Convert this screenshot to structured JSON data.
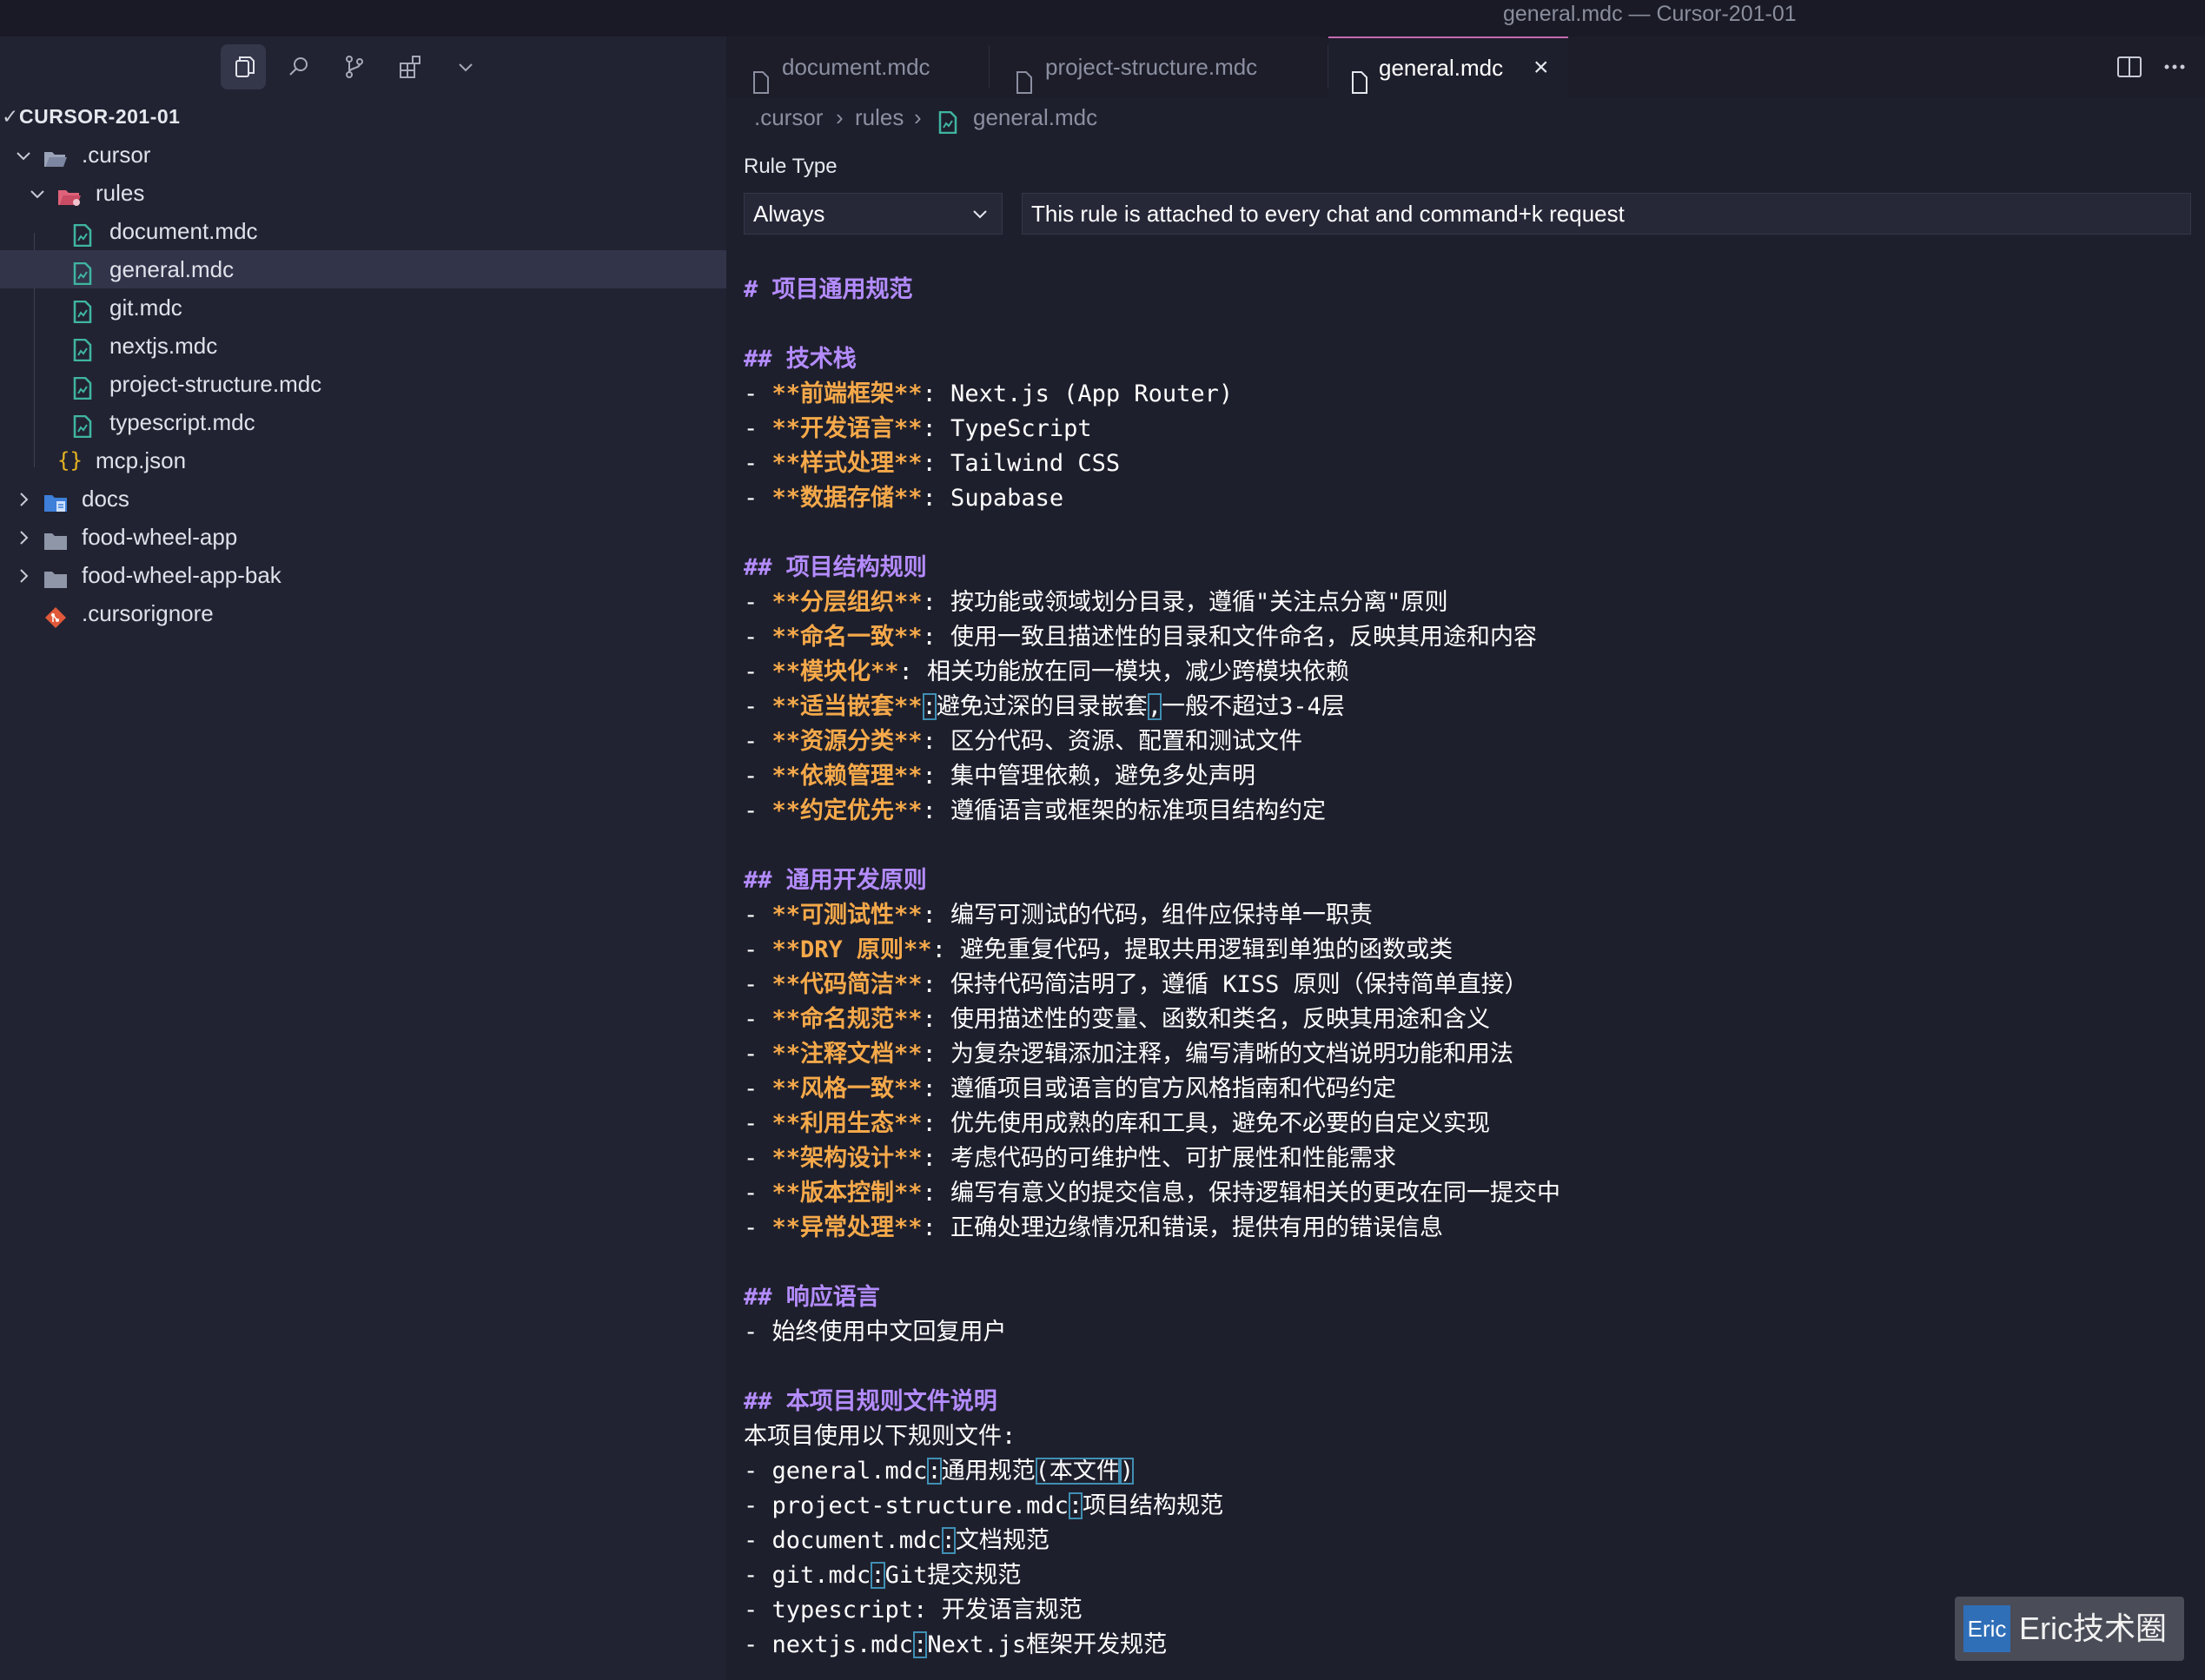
{
  "window": {
    "title": "general.mdc — Cursor-201-01"
  },
  "toolbar": {
    "icons": [
      "files-icon",
      "search-icon",
      "source-control-icon",
      "extensions-icon",
      "chevron-down-icon"
    ]
  },
  "explorer": {
    "root": "CURSOR-201-01",
    "items": [
      {
        "label": ".cursor",
        "kind": "folder-open"
      },
      {
        "label": "rules",
        "kind": "folder-open-rules"
      },
      {
        "label": "document.mdc",
        "kind": "mdc"
      },
      {
        "label": "general.mdc",
        "kind": "mdc",
        "selected": true
      },
      {
        "label": "git.mdc",
        "kind": "mdc"
      },
      {
        "label": "nextjs.mdc",
        "kind": "mdc"
      },
      {
        "label": "project-structure.mdc",
        "kind": "mdc"
      },
      {
        "label": "typescript.mdc",
        "kind": "mdc"
      },
      {
        "label": "mcp.json",
        "kind": "json"
      },
      {
        "label": "docs",
        "kind": "folder-docs"
      },
      {
        "label": "food-wheel-app",
        "kind": "folder"
      },
      {
        "label": "food-wheel-app-bak",
        "kind": "folder"
      },
      {
        "label": ".cursorignore",
        "kind": "git"
      }
    ]
  },
  "tabs": [
    {
      "label": "document.mdc",
      "active": false
    },
    {
      "label": "project-structure.mdc",
      "active": false
    },
    {
      "label": "general.mdc",
      "active": true
    }
  ],
  "breadcrumb": [
    ".cursor",
    "rules",
    "general.mdc"
  ],
  "rule": {
    "label": "Rule Type",
    "type": "Always",
    "description": "This rule is attached to every chat and command+k request"
  },
  "content": {
    "h1": "# 项目通用规范",
    "tech_title": "## 技术栈",
    "tech": [
      {
        "b": "**前端框架**",
        "t": ": Next.js (App Router)"
      },
      {
        "b": "**开发语言**",
        "t": ": TypeScript"
      },
      {
        "b": "**样式处理**",
        "t": ": Tailwind CSS"
      },
      {
        "b": "**数据存储**",
        "t": ": Supabase"
      }
    ],
    "struct_title": "## 项目结构规则",
    "struct": [
      {
        "b": "**分层组织**",
        "t": ": 按功能或领域划分目录，遵循\"关注点分离\"原则"
      },
      {
        "b": "**命名一致**",
        "t": ": 使用一致且描述性的目录和文件命名，反映其用途和内容"
      },
      {
        "b": "**模块化**",
        "t": ": 相关功能放在同一模块，减少跨模块依赖"
      },
      {
        "b": "**适当嵌套**",
        "t1": ":",
        "t2": "避免过深的目录嵌套",
        "t3": ",",
        "t4": "一般不超过3-4层"
      },
      {
        "b": "**资源分类**",
        "t": ": 区分代码、资源、配置和测试文件"
      },
      {
        "b": "**依赖管理**",
        "t": ": 集中管理依赖，避免多处声明"
      },
      {
        "b": "**约定优先**",
        "t": ": 遵循语言或框架的标准项目结构约定"
      }
    ],
    "dev_title": "## 通用开发原则",
    "dev": [
      {
        "b": "**可测试性**",
        "t": ": 编写可测试的代码，组件应保持单一职责"
      },
      {
        "b": "**DRY 原则**",
        "t": ": 避免重复代码，提取共用逻辑到单独的函数或类"
      },
      {
        "b": "**代码简洁**",
        "t": ": 保持代码简洁明了，遵循 KISS 原则（保持简单直接）"
      },
      {
        "b": "**命名规范**",
        "t": ": 使用描述性的变量、函数和类名，反映其用途和含义"
      },
      {
        "b": "**注释文档**",
        "t": ": 为复杂逻辑添加注释，编写清晰的文档说明功能和用法"
      },
      {
        "b": "**风格一致**",
        "t": ": 遵循项目或语言的官方风格指南和代码约定"
      },
      {
        "b": "**利用生态**",
        "t": ": 优先使用成熟的库和工具，避免不必要的自定义实现"
      },
      {
        "b": "**架构设计**",
        "t": ": 考虑代码的可维护性、可扩展性和性能需求"
      },
      {
        "b": "**版本控制**",
        "t": ": 编写有意义的提交信息，保持逻辑相关的更改在同一提交中"
      },
      {
        "b": "**异常处理**",
        "t": ": 正确处理边缘情况和错误，提供有用的错误信息"
      }
    ],
    "lang_title": "## 响应语言",
    "lang": "- 始终使用中文回复用户",
    "files_title": "## 本项目规则文件说明",
    "files_intro": "本项目使用以下规则文件:",
    "files": [
      {
        "a": "- general.mdc",
        "c": ":",
        "d": "通用规范",
        "e": "(本文件",
        "f": ")"
      },
      {
        "a": "- project-structure.mdc",
        "c": ":",
        "d": "项目结构规范"
      },
      {
        "a": "- document.mdc",
        "c": ":",
        "d": "文档规范"
      },
      {
        "a": "- git.mdc",
        "c": ":",
        "d": "Git提交规范"
      },
      {
        "a": "- typescript: 开发语言规范"
      },
      {
        "a": "- nextjs.mdc",
        "c": ":",
        "d": "Next.js框架开发规范"
      }
    ]
  },
  "watermark": {
    "logo": "Eric",
    "text": "Eric技术圈"
  },
  "colors": {
    "heading": "#b48cff",
    "bold": "#f5a94a",
    "accent_tab": "#c56bb0",
    "file_icon": "#3fb5a1"
  }
}
